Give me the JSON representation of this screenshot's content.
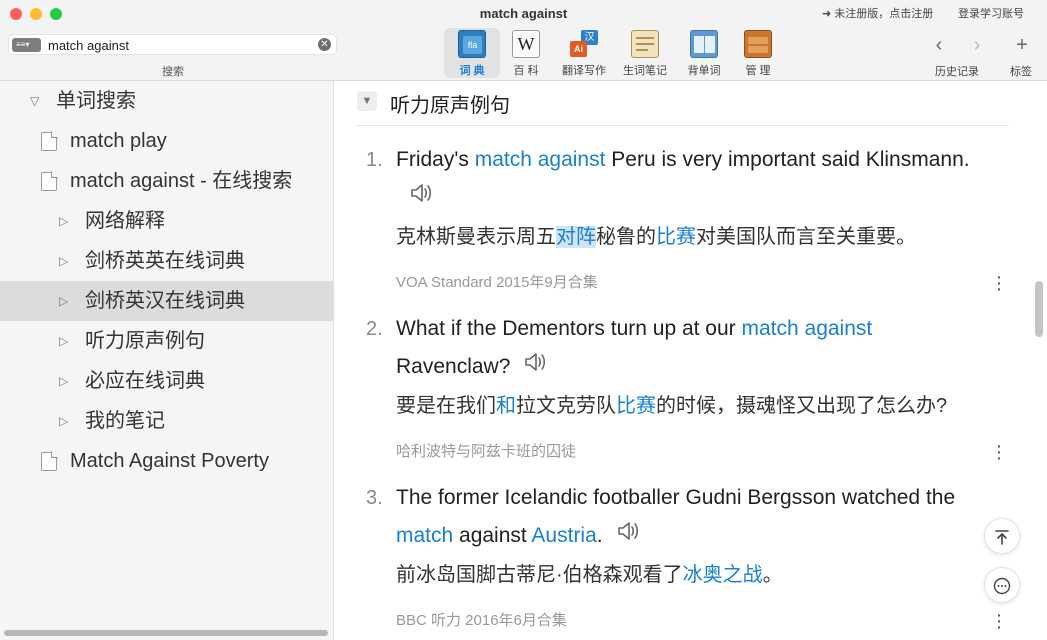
{
  "window": {
    "title": "match against"
  },
  "topbar": {
    "register_text": "➜ 未注册版，点击注册",
    "login_text": "登录学习账号"
  },
  "search": {
    "value": "match against",
    "scope_label": "≡≡▾",
    "caption": "搜索"
  },
  "toolbar": [
    {
      "label": "词 典",
      "icon": "dictionary-icon",
      "active": true
    },
    {
      "label": "百 科",
      "icon": "wikipedia-icon",
      "active": false
    },
    {
      "label": "翻译写作",
      "icon": "translate-icon",
      "active": false
    },
    {
      "label": "生词笔记",
      "icon": "notebook-icon",
      "active": false
    },
    {
      "label": "背单词",
      "icon": "book-icon",
      "active": false
    },
    {
      "label": "管 理",
      "icon": "manage-icon",
      "active": false
    }
  ],
  "nav": {
    "history_label": "历史记录",
    "bookmark_label": "标签"
  },
  "sidebar": {
    "items": [
      {
        "label": "单词搜索",
        "kind": "group-open"
      },
      {
        "label": "match play",
        "kind": "doc"
      },
      {
        "label": "match against - 在线搜索",
        "kind": "doc"
      },
      {
        "label": "网络解释",
        "kind": "child"
      },
      {
        "label": "剑桥英英在线词典",
        "kind": "child"
      },
      {
        "label": "剑桥英汉在线词典",
        "kind": "child",
        "selected": true
      },
      {
        "label": "听力原声例句",
        "kind": "child"
      },
      {
        "label": "必应在线词典",
        "kind": "child"
      },
      {
        "label": "我的笔记",
        "kind": "child"
      },
      {
        "label": "Match Against Poverty",
        "kind": "doc"
      }
    ]
  },
  "content": {
    "section_title": "听力原声例句",
    "examples": [
      {
        "number": "1.",
        "en_parts": [
          "Friday's ",
          "match against",
          " Peru is very important said Klinsmann."
        ],
        "zh_parts": [
          "克林斯曼表示周五",
          "对阵",
          "秘鲁的",
          "比赛",
          "对美国队而言至关重要。"
        ],
        "source": "VOA Standard 2015年9月合集"
      },
      {
        "number": "2.",
        "en_parts": [
          "What if the Dementors turn up at our ",
          "match against",
          " Ravenclaw?"
        ],
        "zh_parts": [
          "要是在我们",
          "和",
          "拉文克劳队",
          "比赛",
          "的时候，摄魂怪又出现了怎么办?"
        ],
        "source": "哈利波特与阿兹卡班的囚徒"
      },
      {
        "number": "3.",
        "en_parts": [
          "The former Icelandic footballer Gudni Bergsson watched the ",
          "match",
          " against ",
          "Austria",
          "."
        ],
        "zh_parts": [
          "前冰岛国脚古蒂尼·伯格森观看了",
          "冰奥之战",
          "。"
        ],
        "source": "BBC 听力 2016年6月合集"
      }
    ]
  },
  "colors": {
    "accent": "#1a7fd6",
    "highlight_bg": "#cfe3fa",
    "sidebar_bg": "#f5f5f5",
    "selected_row": "#dcdcdc"
  }
}
